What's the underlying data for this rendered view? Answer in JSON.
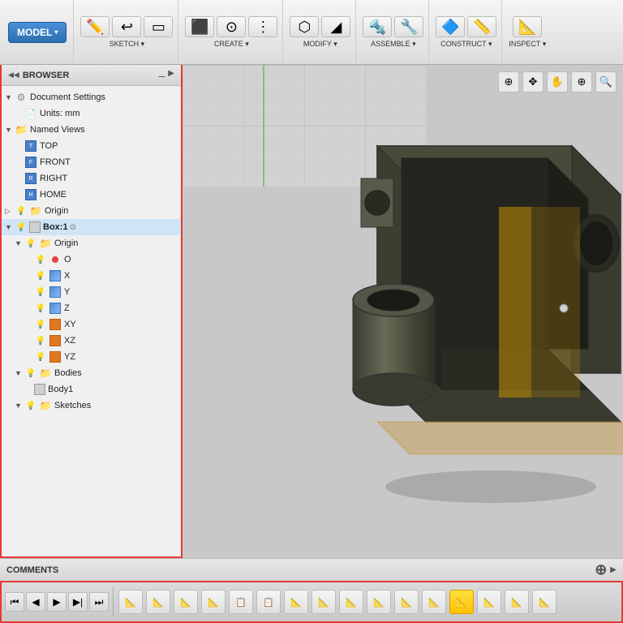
{
  "toolbar": {
    "model_label": "MODEL",
    "groups": [
      {
        "name": "sketch",
        "label": "SKETCH ▾",
        "buttons": [
          "sketch-icon"
        ]
      },
      {
        "name": "create",
        "label": "CREATE ▾",
        "buttons": [
          "create-icon"
        ]
      },
      {
        "name": "modify",
        "label": "MODIFY ▾",
        "buttons": [
          "modify-icon"
        ]
      },
      {
        "name": "assemble",
        "label": "ASSEMBLE ▾",
        "buttons": [
          "assemble-icon"
        ]
      },
      {
        "name": "construct",
        "label": "CONSTRUCT ▾",
        "buttons": [
          "construct-icon"
        ]
      },
      {
        "name": "inspect",
        "label": "INSPECT ▾",
        "buttons": [
          "inspect-icon"
        ]
      }
    ]
  },
  "browser": {
    "title": "BROWSER",
    "items": [
      {
        "indent": 0,
        "arrow": "▼",
        "icon": "gear",
        "label": "Document Settings",
        "eye": false
      },
      {
        "indent": 1,
        "arrow": "",
        "icon": "doc",
        "label": "Units: mm",
        "eye": false
      },
      {
        "indent": 0,
        "arrow": "▼",
        "icon": "folder",
        "label": "Named Views",
        "eye": false
      },
      {
        "indent": 1,
        "arrow": "",
        "icon": "view",
        "label": "TOP",
        "eye": false
      },
      {
        "indent": 1,
        "arrow": "",
        "icon": "view",
        "label": "FRONT",
        "eye": false
      },
      {
        "indent": 1,
        "arrow": "",
        "icon": "view",
        "label": "RIGHT",
        "eye": false
      },
      {
        "indent": 1,
        "arrow": "",
        "icon": "view",
        "label": "HOME",
        "eye": false
      },
      {
        "indent": 0,
        "arrow": "▷",
        "icon": "folder",
        "label": "Origin",
        "eye": true
      },
      {
        "indent": 0,
        "arrow": "▼",
        "icon": "body",
        "label": "Box:1",
        "eye": true,
        "active": true
      },
      {
        "indent": 1,
        "arrow": "▼",
        "icon": "folder",
        "label": "Origin",
        "eye": true
      },
      {
        "indent": 2,
        "arrow": "",
        "icon": "originpt",
        "label": "O",
        "eye": true
      },
      {
        "indent": 2,
        "arrow": "",
        "icon": "axis",
        "label": "X",
        "eye": true
      },
      {
        "indent": 2,
        "arrow": "",
        "icon": "axis",
        "label": "Y",
        "eye": true
      },
      {
        "indent": 2,
        "arrow": "",
        "icon": "axis",
        "label": "Z",
        "eye": true
      },
      {
        "indent": 2,
        "arrow": "",
        "icon": "plane",
        "label": "XY",
        "eye": true
      },
      {
        "indent": 2,
        "arrow": "",
        "icon": "plane",
        "label": "XZ",
        "eye": true
      },
      {
        "indent": 2,
        "arrow": "",
        "icon": "plane",
        "label": "YZ",
        "eye": true
      },
      {
        "indent": 1,
        "arrow": "▼",
        "icon": "folder",
        "label": "Bodies",
        "eye": true
      },
      {
        "indent": 2,
        "arrow": "",
        "icon": "body",
        "label": "Body1",
        "eye": false
      },
      {
        "indent": 1,
        "arrow": "▼",
        "icon": "folder",
        "label": "Sketches",
        "eye": true
      }
    ]
  },
  "comments": {
    "label": "COMMENTS",
    "add_icon": "+"
  },
  "viewport_nav": {
    "buttons": [
      "⊕",
      "✥",
      "✋",
      "⊕",
      "🔍"
    ]
  },
  "bottom_nav": {
    "playback": [
      "⏮",
      "◀",
      "▶",
      "▶|",
      "⏭"
    ],
    "tools": [
      "📐",
      "📐",
      "📐",
      "📐",
      "📋",
      "📋",
      "📐",
      "📐",
      "📐",
      "📐",
      "📐",
      "📐",
      "📐",
      "📐",
      "📐",
      "📐",
      "📐"
    ]
  }
}
